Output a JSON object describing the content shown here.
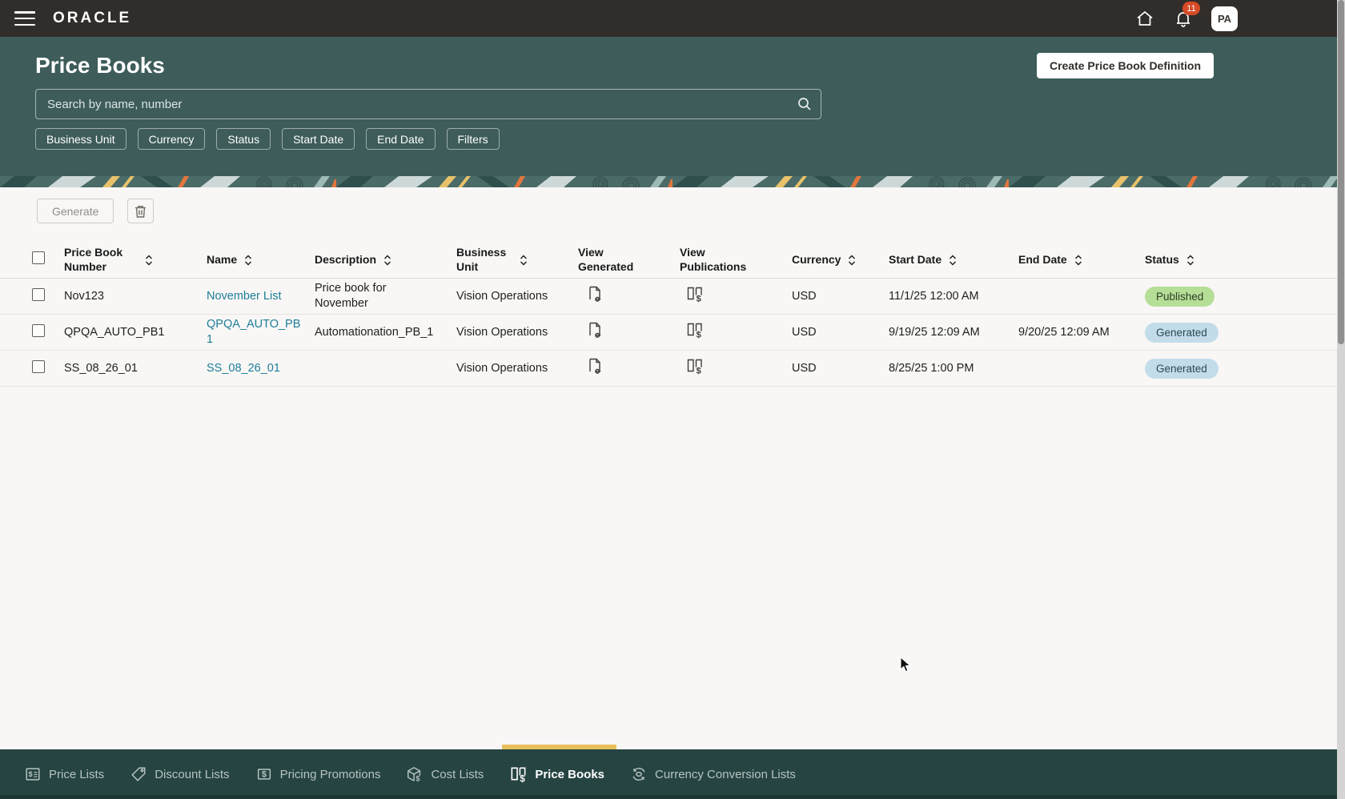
{
  "topbar": {
    "brand": "ORACLE",
    "notification_count": "11",
    "avatar_initials": "PA"
  },
  "hero": {
    "title": "Price Books",
    "create_button_label": "Create Price Book Definition",
    "search_placeholder": "Search by name, number",
    "filters": [
      "Business Unit",
      "Currency",
      "Status",
      "Start Date",
      "End Date",
      "Filters"
    ]
  },
  "toolbar": {
    "generate_label": "Generate"
  },
  "table": {
    "columns": [
      "Price Book Number",
      "Name",
      "Description",
      "Business Unit",
      "View Generated",
      "View Publications",
      "Currency",
      "Start Date",
      "End Date",
      "Status"
    ],
    "rows": [
      {
        "price_book_number": "Nov123",
        "name": "November List",
        "description": "Price book for November",
        "business_unit": "Vision Operations",
        "currency": "USD",
        "start_date": "11/1/25 12:00 AM",
        "end_date": "",
        "status": "Published"
      },
      {
        "price_book_number": "QPQA_AUTO_PB1",
        "name": "QPQA_AUTO_PB1",
        "description": "Automationation_PB_1",
        "business_unit": "Vision Operations",
        "currency": "USD",
        "start_date": "9/19/25 12:09 AM",
        "end_date": "9/20/25 12:09 AM",
        "status": "Generated"
      },
      {
        "price_book_number": "SS_08_26_01",
        "name": "SS_08_26_01",
        "description": "",
        "business_unit": "Vision Operations",
        "currency": "USD",
        "start_date": "8/25/25 1:00 PM",
        "end_date": "",
        "status": "Generated"
      }
    ]
  },
  "bottom_nav": {
    "items": [
      {
        "label": "Price Lists",
        "active": false
      },
      {
        "label": "Discount Lists",
        "active": false
      },
      {
        "label": "Pricing Promotions",
        "active": false
      },
      {
        "label": "Cost Lists",
        "active": false
      },
      {
        "label": "Price Books",
        "active": true
      },
      {
        "label": "Currency Conversion Lists",
        "active": false
      }
    ]
  },
  "colors": {
    "topbar_bg": "#312D2A",
    "hero_bg": "#3D5C5A",
    "bottom_nav_bg": "#254442",
    "active_tab_indicator": "#E7C05C",
    "link": "#1D7E99",
    "badge_published_bg": "#B5DE97",
    "badge_generated_bg": "#C2DCEA",
    "notification_badge_bg": "#D64A26",
    "page_bg": "#F8F7F5"
  }
}
